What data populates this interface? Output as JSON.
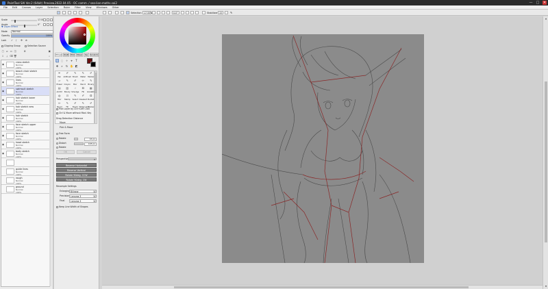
{
  "window": {
    "title": "PaintTool SAI Ver.2 (64bit) Preview.2022.04.05 - OC comm. / sea-lion-maths.sai2",
    "controls": [
      "—",
      "□",
      "✕"
    ]
  },
  "menu": [
    "File",
    "Edit",
    "Canvas",
    "Layer",
    "Selection",
    "Ruler",
    "Filter",
    "View",
    "Windows",
    "Other"
  ],
  "toolbar": {
    "selection_label": "Selection",
    "zoom_value": "17.55%",
    "angle_value": "0.0°",
    "stabilizer_label": "Stabilizer",
    "stabilizer_value": "15"
  },
  "navigator": {
    "scale_label": "Scale",
    "scale_value": "17.55%",
    "angle_label": "Angle",
    "angle_value": "0°"
  },
  "layer_effect_label": "▼ Layer Effect",
  "layer_props": {
    "mode_label": "Mode",
    "mode_value": "Normal",
    "opacity_label": "Opacity",
    "opacity_value": "100%",
    "opacity_fraction": 1.0,
    "lock_label": "Lock",
    "clipping_label": "Clipping Group",
    "selection_source_label": "Selection Source"
  },
  "layers": [
    {
      "name": "cross sketch",
      "blend": "Normal",
      "opacity": "100%",
      "selected": false
    },
    {
      "name": "beach chair sketch",
      "blend": "Normal",
      "opacity": "100%",
      "selected": false
    },
    {
      "name": "lines",
      "blend": "Normal",
      "opacity": "100%",
      "selected": false
    },
    {
      "name": "swimsuit sketch",
      "blend": "Normal",
      "opacity": "100%",
      "selected": true
    },
    {
      "name": "hair sketch lower",
      "blend": "Normal",
      "opacity": "100%",
      "selected": false
    },
    {
      "name": "hair sketch new",
      "blend": "Normal",
      "opacity": "100%",
      "selected": false
    },
    {
      "name": "hair sketch",
      "blend": "Normal",
      "opacity": "100%",
      "selected": false
    },
    {
      "name": "face sketch upper",
      "blend": "Normal",
      "opacity": "100%",
      "selected": false
    },
    {
      "name": "face sketch",
      "blend": "Normal",
      "opacity": "100%",
      "selected": false
    },
    {
      "name": "head sketch",
      "blend": "Normal",
      "opacity": "100%",
      "selected": false
    },
    {
      "name": "body sketch",
      "blend": "Normal",
      "opacity": "100%",
      "selected": false
    },
    {
      "name": "",
      "blend": "",
      "opacity": "",
      "selected": false
    },
    {
      "name": "guide lines",
      "blend": "Normal",
      "opacity": "100%",
      "selected": false
    },
    {
      "name": "rough",
      "blend": "Normal",
      "opacity": "100%",
      "selected": false
    },
    {
      "name": "ground",
      "blend": "Normal",
      "opacity": "100%",
      "selected": false
    }
  ],
  "color_tabs": [
    "Wheel",
    "RGB",
    "HSV",
    "Mixer",
    "Sw",
    "Scratch"
  ],
  "colors": {
    "primary": "#6a1010",
    "secondary": "#000000",
    "accent": "#3b7ad8"
  },
  "tools": [
    [
      "Pen",
      "AirBrush",
      "Brush",
      "Water",
      "Marker"
    ],
    [
      "Eraser",
      "Crayon",
      "Blur",
      "Pencil",
      "Binary"
    ],
    [
      "AirCtrl",
      "Binary",
      "Smudge",
      "Fill",
      "Gradation"
    ],
    [
      "Blur",
      "Stamp",
      "Select",
      "Deselect",
      "Bucket"
    ],
    [
      "Pencil",
      "Fill",
      "Brush",
      "Watercolor",
      "Marker"
    ]
  ],
  "move_options": {
    "pick_layer_label": "Pick Layer by Ctrl+Left Click",
    "cut_move_label": "Ctrl & Move without Mod. Key",
    "drag_distance_label": "Drag Detection Distance",
    "move_label": "Move",
    "move_value": "16 px",
    "pick_move_label": "Pick & Move",
    "pick_move_value": "128 px"
  },
  "transform": {
    "options": [
      "Free Form",
      "Rotate",
      "Distort",
      "Rotate"
    ],
    "ok_label": "OK",
    "cancel_label": "Cancel",
    "perspective_label": "Perspective",
    "perspective_value": "0",
    "buttons": [
      "Reverse Horizontal",
      "Reverse Vertical",
      "Rotate 90deg. CCW",
      "Rotate 90deg. CW"
    ]
  },
  "resample": {
    "label": "Resample Settings",
    "enlarging_label": "Enlarging",
    "enlarging_value": "Bilinear",
    "precision_label": "Precision",
    "precision_value": "Lanczos 3",
    "final_label": "Final",
    "final_value": "Lanczos 3",
    "keep_line_label": "Keep Line Width of Shapes"
  }
}
